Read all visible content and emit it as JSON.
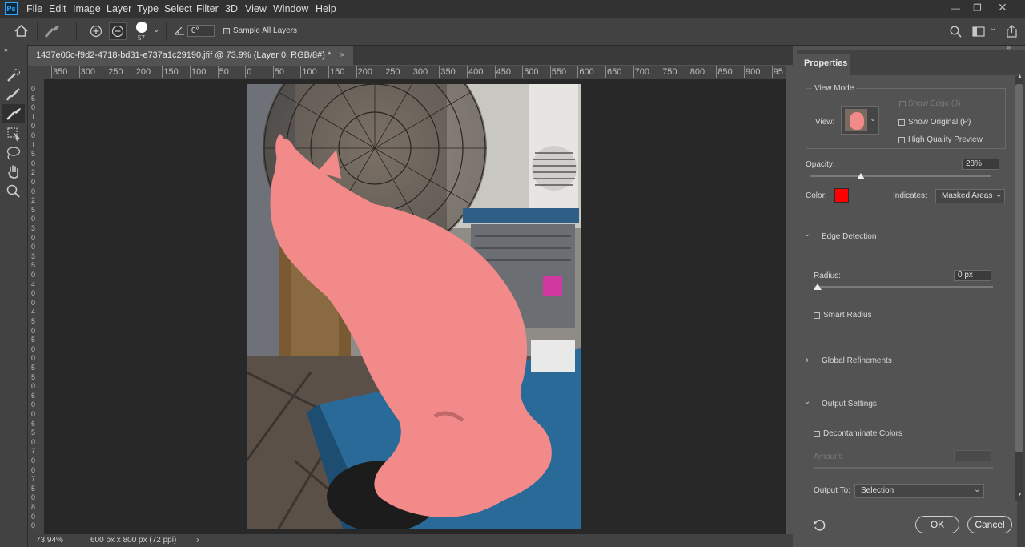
{
  "menu": [
    "File",
    "Edit",
    "Image",
    "Layer",
    "Type",
    "Select",
    "Filter",
    "3D",
    "View",
    "Window",
    "Help"
  ],
  "options_bar": {
    "brush_size": "57",
    "angle_value": "0°",
    "sample_all_layers": "Sample All Layers"
  },
  "document": {
    "tab_title": "1437e06c-f9d2-4718-bd31-e737a1c29190.jfif @ 73.9% (Layer 0, RGB/8#) *",
    "close_glyph": "×"
  },
  "ruler": {
    "h_labels": [
      "350",
      "300",
      "250",
      "200",
      "150",
      "100",
      "50",
      "0",
      "50",
      "100",
      "150",
      "200",
      "250",
      "300",
      "350",
      "400",
      "450",
      "500",
      "550",
      "600",
      "650",
      "700",
      "750",
      "800",
      "850",
      "900",
      "95"
    ],
    "v_labels": [
      "0",
      "5",
      "0",
      "1",
      "0",
      "0",
      "1",
      "5",
      "0",
      "2",
      "0",
      "0",
      "2",
      "5",
      "0",
      "3",
      "0",
      "0",
      "3",
      "5",
      "0",
      "4",
      "0",
      "0",
      "4",
      "5",
      "0",
      "5",
      "0",
      "0",
      "5",
      "5",
      "0",
      "6",
      "0",
      "0",
      "6",
      "5",
      "0",
      "7",
      "0",
      "0",
      "7",
      "5",
      "0",
      "8",
      "0",
      "0"
    ]
  },
  "status": {
    "zoom": "73.94%",
    "doc_info": "600 px x 800 px (72 ppi)"
  },
  "properties": {
    "tab": "Properties",
    "view_mode": {
      "heading": "View Mode",
      "view_label": "View:",
      "show_edge": "Show Edge (J)",
      "show_original": "Show Original (P)",
      "high_quality": "High Quality Preview"
    },
    "opacity_label": "Opacity:",
    "opacity_value": "28%",
    "opacity_level": 28,
    "color_label": "Color:",
    "overlay_color": "#ff0000",
    "indicates_label": "Indicates:",
    "indicates_value": "Masked Areas",
    "edge_detection": {
      "heading": "Edge Detection",
      "radius_label": "Radius:",
      "radius_value": "0 px",
      "smart_radius": "Smart Radius"
    },
    "global_refinements": "Global Refinements",
    "output_settings": {
      "heading": "Output Settings",
      "decontaminate": "Decontaminate Colors",
      "amount_label": "Amount:",
      "output_to_label": "Output To:",
      "output_to_value": "Selection"
    },
    "ok": "OK",
    "cancel": "Cancel"
  },
  "colors": {
    "accent_ps": "#31a8ff",
    "overlay": "#ff0000",
    "mask_tint": "#f28a8a"
  }
}
